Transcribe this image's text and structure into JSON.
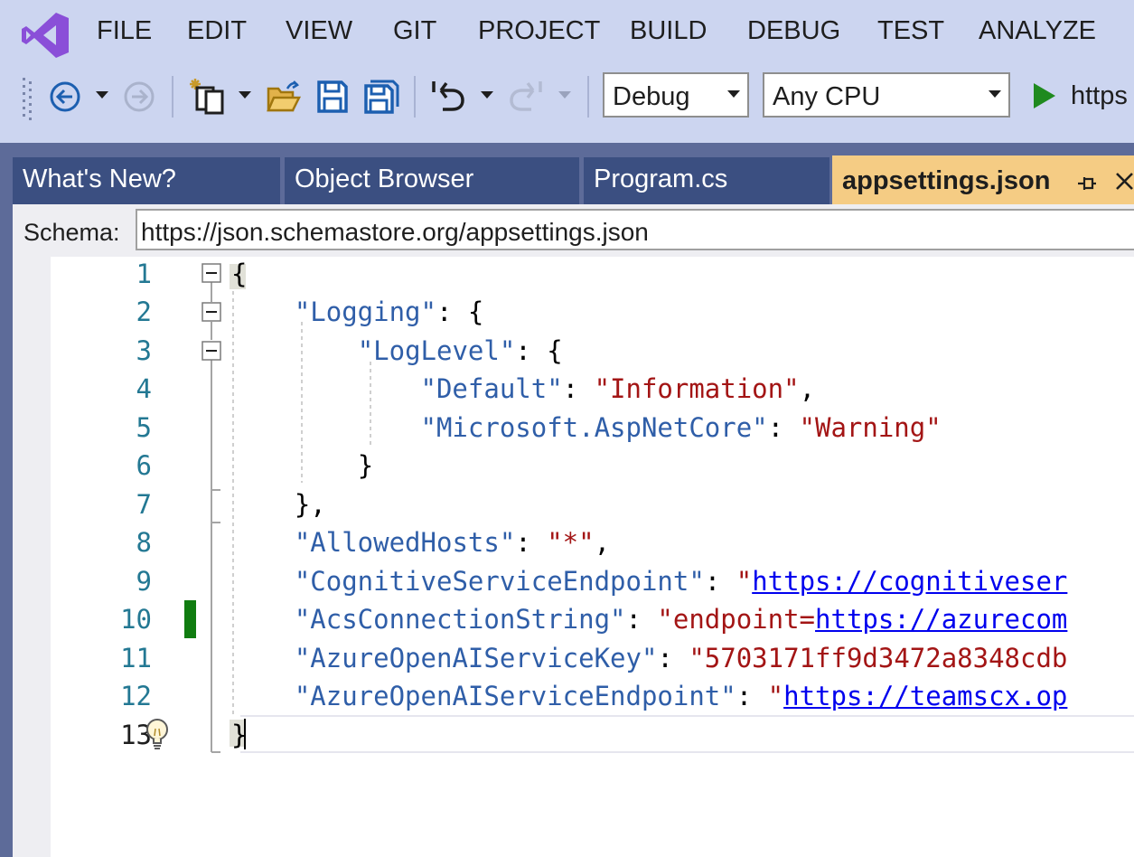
{
  "menu": {
    "logo_icon": "visual-studio-logo",
    "items": [
      "FILE",
      "EDIT",
      "VIEW",
      "GIT",
      "PROJECT",
      "BUILD",
      "DEBUG",
      "TEST",
      "ANALYZE"
    ]
  },
  "toolbar": {
    "configuration": "Debug",
    "platform": "Any CPU",
    "run_target": "https",
    "icons": [
      "navigate-back-icon",
      "navigate-forward-icon",
      "new-project-icon",
      "open-folder-icon",
      "save-icon",
      "save-all-icon",
      "undo-icon",
      "redo-icon",
      "start-debugging-icon"
    ]
  },
  "tabs": [
    {
      "label": "What's New?"
    },
    {
      "label": "Object Browser"
    },
    {
      "label": "Program.cs"
    },
    {
      "label": "appsettings.json",
      "active": true
    }
  ],
  "schema": {
    "label": "Schema:",
    "value": "https://json.schemastore.org/appsettings.json"
  },
  "editor": {
    "line_numbers": [
      "1",
      "2",
      "3",
      "4",
      "5",
      "6",
      "7",
      "8",
      "9",
      "10",
      "11",
      "12",
      "13"
    ],
    "current_line": "13",
    "lines": {
      "l1": {
        "punct": "{"
      },
      "l2": {
        "key": "\"Logging\"",
        "punct": ": {"
      },
      "l3": {
        "key": "\"LogLevel\"",
        "punct": ": {"
      },
      "l4": {
        "key": "\"Default\"",
        "colon": ": ",
        "value": "\"Information\"",
        "trail": ","
      },
      "l5": {
        "key": "\"Microsoft.AspNetCore\"",
        "colon": ": ",
        "value": "\"Warning\""
      },
      "l6": {
        "punct": "}"
      },
      "l7": {
        "punct": "},"
      },
      "l8": {
        "key": "\"AllowedHosts\"",
        "colon": ": ",
        "value": "\"*\"",
        "trail": ","
      },
      "l9": {
        "key": "\"CognitiveServiceEndpoint\"",
        "colon": ": ",
        "quote": "\"",
        "link": "https://cognitiveser"
      },
      "l10": {
        "key": "\"AcsConnectionString\"",
        "colon": ": ",
        "value": "\"endpoint=",
        "link": "https://azurecom"
      },
      "l11": {
        "key": "\"AzureOpenAIServiceKey\"",
        "colon": ": ",
        "value": "\"5703171ff9d3472a8348cdb"
      },
      "l12": {
        "key": "\"AzureOpenAIServiceEndpoint\"",
        "colon": ": ",
        "quote": "\"",
        "link": "https://teamscx.op"
      },
      "l13": {
        "punct": "}"
      }
    }
  },
  "colors": {
    "chrome": "#ccd5f0",
    "frame": "#5d6b99",
    "tab_inactive": "#3b4f81",
    "tab_active": "#f5cc84",
    "json_key": "#2f5ea8",
    "json_string": "#a31515",
    "link": "#0000ee",
    "change_marker": "#107c10"
  }
}
